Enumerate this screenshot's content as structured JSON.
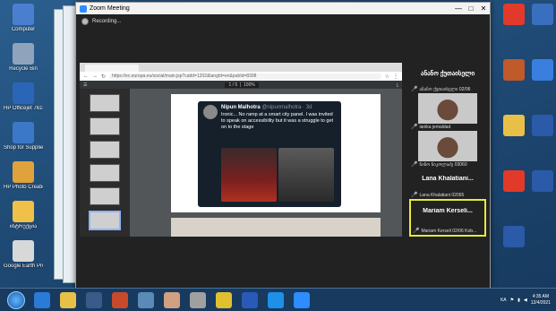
{
  "desktop_left": [
    {
      "label": "Computer",
      "color": "#4a7fd0"
    },
    {
      "label": "Recycle Bin",
      "color": "#8fa4bc"
    },
    {
      "label": "HP Officejet 7610 series",
      "color": "#2a66b8"
    },
    {
      "label": "Shop for Supplies",
      "color": "#3b78c8"
    },
    {
      "label": "HP Photo Creations",
      "color": "#e0a23b"
    },
    {
      "label": "ისტრუქცია",
      "color": "#f0c048"
    },
    {
      "label": "Google Earth Pro",
      "color": "#d8d8d8"
    }
  ],
  "desktop_right": [
    {
      "label": "",
      "color": "#e23a2a"
    },
    {
      "label": "",
      "color": "#3a6fc0"
    },
    {
      "label": "",
      "color": "#c05a2a"
    },
    {
      "label": "",
      "color": "#3a7fe0"
    },
    {
      "label": "",
      "color": "#e8c048"
    },
    {
      "label": "",
      "color": "#2a5aa8"
    },
    {
      "label": "",
      "color": "#e23a2a"
    },
    {
      "label": "",
      "color": "#2a5aa8"
    },
    {
      "label": "",
      "color": "#2a5aa8"
    }
  ],
  "zoom": {
    "title": "Zoom Meeting",
    "recording_label": "Recording...",
    "window_controls": [
      "—",
      "□",
      "✕"
    ]
  },
  "browser": {
    "address": "https://ec.europa.eu/social/main.jsp?catId=1202&langId=en&pubId=8398",
    "pdf_page": "1 / 5",
    "pdf_zoom": "100%"
  },
  "tweet": {
    "name": "Nipun Malhotra",
    "handle": "@nipunmalhotra · 3d",
    "text": "Ironic... No ramp at a smart city panel. I was invited to speak on accessibility but it was a struggle to get on to the stage"
  },
  "participants": [
    {
      "name": "ანანო ქუთაისელი",
      "sub": "ანანო ქუთაისელი 02/06",
      "type": "name"
    },
    {
      "name": "",
      "sub": "ianika jemaldad",
      "type": "photo"
    },
    {
      "name": "",
      "sub": "ნინო ნიკოლაძე 03060",
      "type": "photo"
    },
    {
      "name": "Lana Khalatiani...",
      "sub": "Lana Khalatiani 02065",
      "type": "name"
    },
    {
      "name": "Mariam Kerseli...",
      "sub": "Mariam Kerseli 02/06 Kob...",
      "type": "name",
      "active": true
    }
  ],
  "taskbar": {
    "apps": [
      {
        "name": "ie",
        "color": "#2a7ad8"
      },
      {
        "name": "explorer",
        "color": "#e8c048"
      },
      {
        "name": "media",
        "color": "#3a5a8a"
      },
      {
        "name": "paint",
        "color": "#c84a2a"
      },
      {
        "name": "chess",
        "color": "#5a8ab8"
      },
      {
        "name": "photo",
        "color": "#d0a080"
      },
      {
        "name": "settings",
        "color": "#a0a0a0"
      },
      {
        "name": "chrome",
        "color": "#e0c030"
      },
      {
        "name": "word",
        "color": "#2a5ab8"
      },
      {
        "name": "skype",
        "color": "#1e90e8"
      },
      {
        "name": "zoom",
        "color": "#2d8cff"
      }
    ],
    "lang": "KA",
    "time": "4:35 AM",
    "date": "12/4/2021"
  }
}
